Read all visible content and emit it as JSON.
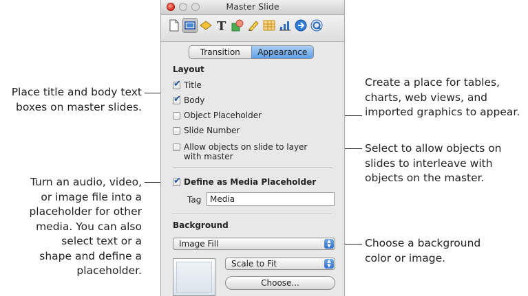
{
  "window": {
    "title": "Master Slide"
  },
  "toolbar": {
    "icons": [
      "document-icon",
      "slide-icon",
      "transition-icon",
      "text-icon",
      "shape-icon",
      "graphic-icon",
      "table-icon",
      "chart-icon",
      "hyperlink-icon",
      "quicktime-icon"
    ],
    "selected": "slide-icon"
  },
  "tabs": [
    "Transition",
    "Appearance"
  ],
  "active_tab": "Appearance",
  "layout": {
    "heading": "Layout",
    "title": "Title",
    "body": "Body",
    "object_placeholder": "Object Placeholder",
    "slide_number": "Slide Number",
    "allow_layer_1": "Allow objects on slide to layer",
    "allow_layer_2": "with master"
  },
  "media": {
    "define_label": "Define as Media Placeholder",
    "tag_label": "Tag",
    "tag_value": "Media"
  },
  "background": {
    "heading": "Background",
    "fill": "Image Fill",
    "scale": "Scale to Fit",
    "choose": "Choose..."
  },
  "callouts": {
    "title_body": [
      "Place title and body text",
      "boxes on master slides."
    ],
    "object_placeholder": [
      "Create a place for tables,",
      "charts, web views, and",
      "imported graphics to appear."
    ],
    "allow_objects": [
      "Select to allow objects on",
      "slides to interleave with",
      "objects on the master."
    ],
    "media": [
      "Turn an audio, video,",
      "or image file into a",
      "placeholder for other",
      "media. You can also",
      "select text or a",
      "shape and define a",
      "placeholder."
    ],
    "background": [
      "Choose a background",
      "color or image."
    ]
  }
}
